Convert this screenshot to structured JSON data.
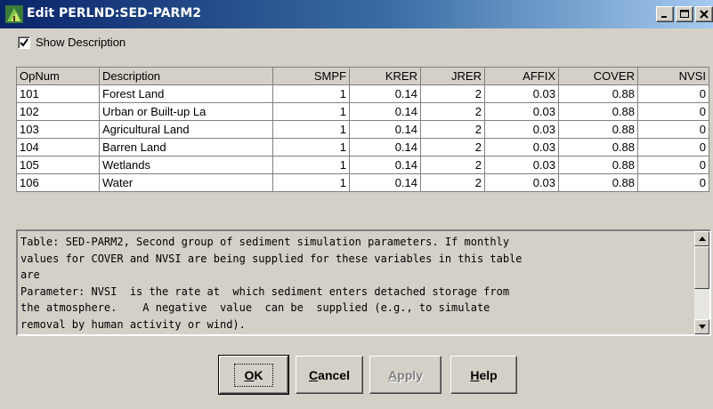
{
  "window": {
    "title": "Edit PERLND:SED-PARM2"
  },
  "show_description": {
    "label": "Show Description",
    "checked": true
  },
  "table": {
    "columns": [
      "OpNum",
      "Description",
      "SMPF",
      "KRER",
      "JRER",
      "AFFIX",
      "COVER",
      "NVSI"
    ],
    "rows": [
      [
        "101",
        "Forest Land",
        "1",
        "0.14",
        "2",
        "0.03",
        "0.88",
        "0"
      ],
      [
        "102",
        "Urban or Built-up La",
        "1",
        "0.14",
        "2",
        "0.03",
        "0.88",
        "0"
      ],
      [
        "103",
        "Agricultural Land",
        "1",
        "0.14",
        "2",
        "0.03",
        "0.88",
        "0"
      ],
      [
        "104",
        "Barren Land",
        "1",
        "0.14",
        "2",
        "0.03",
        "0.88",
        "0"
      ],
      [
        "105",
        "Wetlands",
        "1",
        "0.14",
        "2",
        "0.03",
        "0.88",
        "0"
      ],
      [
        "106",
        "Water",
        "1",
        "0.14",
        "2",
        "0.03",
        "0.88",
        "0"
      ]
    ]
  },
  "description": {
    "text": "Table: SED-PARM2, Second group of sediment simulation parameters. If monthly\nvalues for COVER and NVSI are being supplied for these variables in this table\nare\nParameter: NVSI  is the rate at  which sediment enters detached storage from\nthe atmosphere.    A negative  value  can be  supplied (e.g., to simulate\nremoval by human activity or wind)."
  },
  "buttons": {
    "ok": {
      "hotkey": "O",
      "rest": "K"
    },
    "cancel": {
      "hotkey": "C",
      "rest": "ancel"
    },
    "apply": {
      "hotkey": "A",
      "rest": "pply"
    },
    "help": {
      "hotkey": "H",
      "rest": "elp"
    }
  },
  "icons": {
    "app": "green-leaf-icon",
    "minimize": "minimize-icon",
    "maximize": "maximize-icon",
    "close": "close-icon"
  },
  "colors": {
    "titlebar_start": "#0a246a",
    "titlebar_end": "#a6caf0",
    "face": "#d4d0c8"
  }
}
